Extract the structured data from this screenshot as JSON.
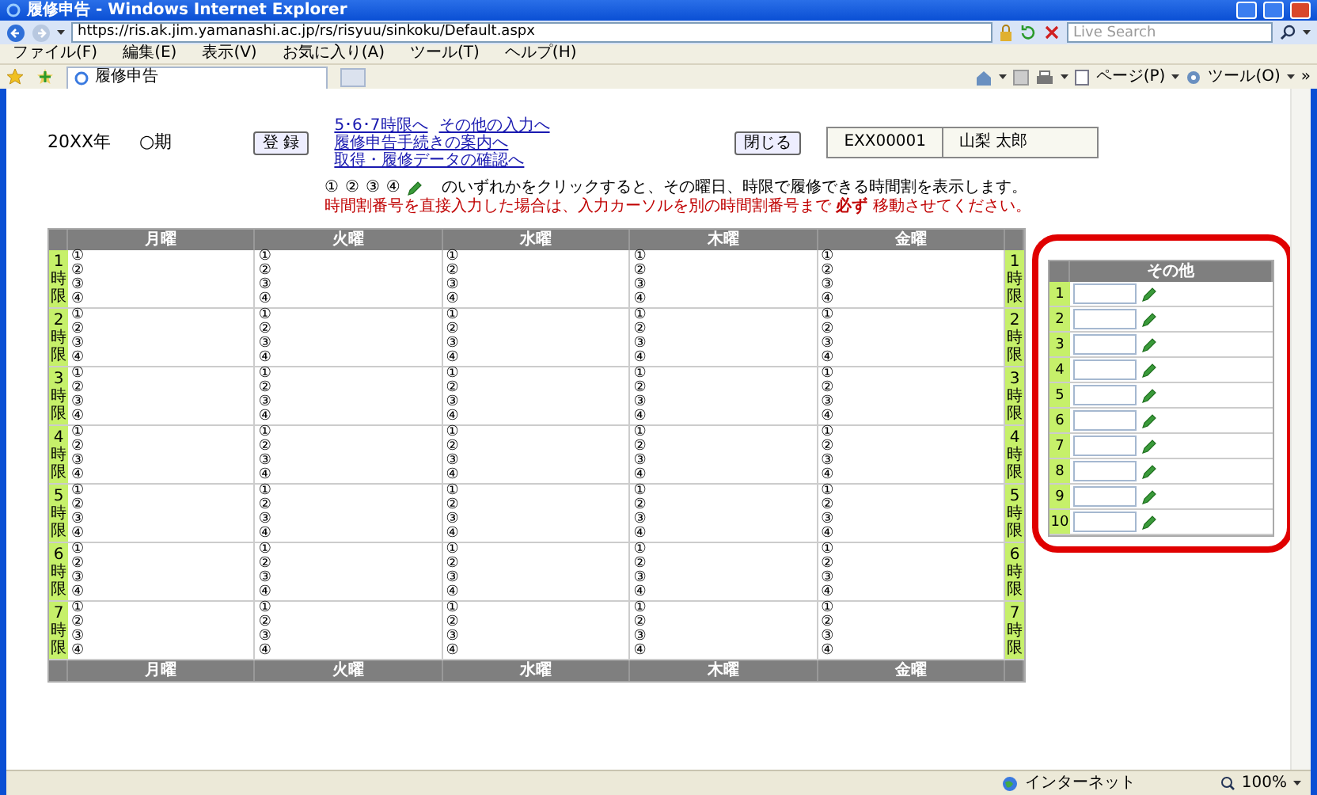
{
  "window": {
    "title": "履修申告 - Windows Internet Explorer"
  },
  "address_bar": {
    "url": "https://ris.ak.jim.yamanashi.ac.jp/rs/risyuu/sinkoku/Default.aspx"
  },
  "search": {
    "placeholder": "Live Search"
  },
  "menu": [
    "ファイル(F)",
    "編集(E)",
    "表示(V)",
    "お気に入り(A)",
    "ツール(T)",
    "ヘルプ(H)"
  ],
  "tabs": [
    {
      "label": "履修申告",
      "selected": true
    }
  ],
  "command_bar": {
    "items": [
      "ページ(P)",
      "ツール(O)"
    ],
    "overflow": "»"
  },
  "page": {
    "year": "20XX年",
    "term": "○期",
    "register_button": "登 録",
    "links": [
      "5･6･7時限へ",
      "その他の入力へ",
      "履修申告手続きの案内へ",
      "取得・履修データの確認へ"
    ],
    "close_button": "閉じる",
    "student_id": "EXX00001",
    "student_name": "山梨 太郎",
    "instruction_marks": [
      "①",
      "②",
      "③",
      "④"
    ],
    "instruction": "のいずれかをクリックすると、その曜日、時限で履修できる時間割を表示します。",
    "warning": "時間割番号を直接入力した場合は、入力カーソルを別の時間割番号まで **必ず** 移動させてください。"
  },
  "timetable": {
    "columns": [
      "月曜",
      "火曜",
      "水曜",
      "木曜",
      "金曜"
    ],
    "rows": [
      {
        "left_label": "1時限",
        "right_label": "1時限",
        "cells": [
          [
            "①",
            "②",
            "③",
            "④"
          ],
          [
            "①",
            "②",
            "③",
            "④"
          ],
          [
            "①",
            "②",
            "③",
            "④"
          ],
          [
            "①",
            "②",
            "③",
            "④"
          ],
          [
            "①",
            "②",
            "③",
            "④"
          ]
        ]
      },
      {
        "left_label": "2時限",
        "right_label": "2時限",
        "cells": [
          [
            "①",
            "②",
            "③",
            "④"
          ],
          [
            "①",
            "②",
            "③",
            "④"
          ],
          [
            "①",
            "②",
            "③",
            "④"
          ],
          [
            "①",
            "②",
            "③",
            "④"
          ],
          [
            "①",
            "②",
            "③",
            "④"
          ]
        ]
      },
      {
        "left_label": "3時限",
        "right_label": "3時限",
        "cells": [
          [
            "①",
            "②",
            "③",
            "④"
          ],
          [
            "①",
            "②",
            "③",
            "④"
          ],
          [
            "①",
            "②",
            "③",
            "④"
          ],
          [
            "①",
            "②",
            "③",
            "④"
          ],
          [
            "①",
            "②",
            "③",
            "④"
          ]
        ]
      },
      {
        "left_label": "4時限",
        "right_label": "4時限",
        "cells": [
          [
            "①",
            "②",
            "③",
            "④"
          ],
          [
            "①",
            "②",
            "③",
            "④"
          ],
          [
            "①",
            "②",
            "③",
            "④"
          ],
          [
            "①",
            "②",
            "③",
            "④"
          ],
          [
            "①",
            "②",
            "③",
            "④"
          ]
        ]
      },
      {
        "left_label": "5時限",
        "right_label": "5時限",
        "cells": [
          [
            "①",
            "②",
            "③",
            "④"
          ],
          [
            "①",
            "②",
            "③",
            "④"
          ],
          [
            "①",
            "②",
            "③",
            "④"
          ],
          [
            "①",
            "②",
            "③",
            "④"
          ],
          [
            "①",
            "②",
            "③",
            "④"
          ]
        ]
      },
      {
        "left_label": "6時限",
        "right_label": "6時限",
        "cells": [
          [
            "①",
            "②",
            "③",
            "④"
          ],
          [
            "①",
            "②",
            "③",
            "④"
          ],
          [
            "①",
            "②",
            "③",
            "④"
          ],
          [
            "①",
            "②",
            "③",
            "④"
          ],
          [
            "①",
            "②",
            "③",
            "④"
          ]
        ]
      },
      {
        "left_label": "7時限",
        "right_label": "7時限",
        "cells": [
          [
            "①",
            "②",
            "③",
            "④"
          ],
          [
            "①",
            "②",
            "③",
            "④"
          ],
          [
            "①",
            "②",
            "③",
            "④"
          ],
          [
            "①",
            "②",
            "③",
            "④"
          ],
          [
            "①",
            "②",
            "③",
            "④"
          ]
        ]
      }
    ],
    "footer": [
      "月曜",
      "火曜",
      "水曜",
      "木曜",
      "金曜"
    ]
  },
  "other": {
    "title": "その他",
    "rows": [
      {
        "number": "1"
      },
      {
        "number": "2"
      },
      {
        "number": "3"
      },
      {
        "number": "4"
      },
      {
        "number": "5"
      },
      {
        "number": "6"
      },
      {
        "number": "7"
      },
      {
        "number": "8"
      },
      {
        "number": "9"
      },
      {
        "number": "10"
      }
    ]
  },
  "status_bar": {
    "zone": "インターネット",
    "zoom": "100%"
  }
}
